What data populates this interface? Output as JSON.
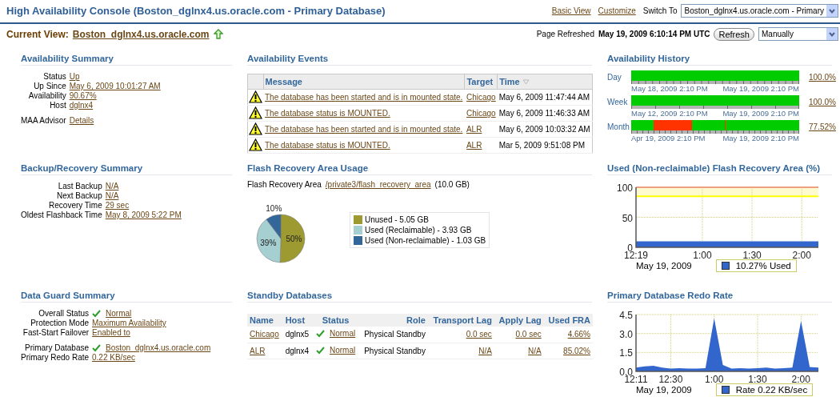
{
  "header": {
    "title": "High Availability Console (Boston_dglnx4.us.oracle.com - Primary Database)",
    "links": [
      "Basic View",
      "Customize"
    ],
    "switch_label": "Switch To",
    "switch_value": "Boston_dglnx4.us.oracle.com - Primary",
    "current_view_label": "Current View:",
    "current_view": "Boston_dglnx4.us.oracle.com",
    "refreshed_label": "Page Refreshed",
    "refreshed_time": "May 19, 2009 6:10:14 PM UTC",
    "refresh_button": "Refresh",
    "refresh_mode": "Manually"
  },
  "availability_summary": {
    "title": "Availability Summary",
    "groups": [
      [
        {
          "label": "Status",
          "value": "Up"
        },
        {
          "label": "Up Since",
          "value": "May 6, 2009 10:01:27 AM"
        },
        {
          "label": "Availability",
          "value": "90.67%"
        },
        {
          "label": "Host",
          "value": "dglnx4"
        }
      ],
      [
        {
          "label": "MAA Advisor",
          "value": "Details"
        }
      ]
    ]
  },
  "availability_events": {
    "title": "Availability Events",
    "columns": [
      {
        "label": "Message",
        "sorted": false
      },
      {
        "label": "Target",
        "sorted": false
      },
      {
        "label": "Time",
        "sorted": true
      }
    ],
    "rows": [
      {
        "kind": "warning",
        "message": "The database has been started and is in mounted state.",
        "target": "Chicago",
        "time": "May 6, 2009 11:47:44 AM"
      },
      {
        "kind": "warning",
        "message": "The database status is MOUNTED.",
        "target": "Chicago",
        "time": "May 6, 2009 11:46:33 AM"
      },
      {
        "kind": "warning",
        "message": "The database has been started and is in mounted state.",
        "target": "ALR",
        "time": "May 6, 2009 10:03:32 AM"
      },
      {
        "kind": "warning",
        "message": "The database status is MOUNTED.",
        "target": "ALR",
        "time": "Mar 5, 2009 9:51:08 PM"
      }
    ]
  },
  "availability_history": {
    "title": "Availability History",
    "rows": [
      {
        "kind": "day",
        "label": "Day",
        "percent": "100.0%",
        "start": "May 18, 2009 2:10 PM",
        "end": "May 19, 2009 2:10 PM"
      },
      {
        "kind": "week",
        "label": "Week",
        "percent": "100.0%",
        "start": "May 12, 2009 2:10 PM",
        "end": "May 19, 2009 2:10 PM"
      },
      {
        "kind": "month",
        "label": "Month",
        "percent": "77.52%",
        "start": "Apr 19, 2009 2:10 PM",
        "end": "May 19, 2009 2:10 PM"
      }
    ]
  },
  "backup_recovery_summary": {
    "title": "Backup/Recovery Summary",
    "groups": [
      [
        {
          "label": "Last Backup",
          "value": "N/A"
        },
        {
          "label": "Next Backup",
          "value": "N/A"
        },
        {
          "label": "Recovery Time",
          "value": "29 sec"
        },
        {
          "label": "Oldest Flashback Time",
          "value": "May 8, 2009 5:22 PM"
        }
      ]
    ]
  },
  "flash_recovery_area_usage": {
    "title": "Flash Recovery Area Usage",
    "label": "Flash Recovery Area",
    "path": "/private3/flash_recovery_area",
    "size": "(10.0 GB)",
    "chart_data": {
      "type": "pie",
      "categories": [
        "Unused - 5.05 GB",
        "Used (Reclaimable) - 3.93 GB",
        "Used (Non-reclaimable) - 1.03 GB"
      ],
      "series": [
        {
          "values": [
            50.5,
            39.2,
            10.3
          ]
        }
      ],
      "colors": [
        "#9c9a30",
        "#a6cfd2",
        "#336699"
      ],
      "value_labels": [
        "50%",
        "39%",
        "10%"
      ]
    }
  },
  "used_fra_chart": {
    "title": "Used (Non-reclaimable) Flash Recovery Area (%)",
    "chart_data": {
      "type": "area",
      "xlabel": "May 19, 2009",
      "categories": [
        "12:19",
        null,
        null,
        null,
        "1:00",
        null,
        null,
        "1:30",
        null,
        null,
        "2:00",
        null
      ],
      "series": [
        {
          "name": "10.27% Used",
          "color": "#3366cc",
          "values": [
            10,
            10,
            10,
            10,
            10,
            10,
            10,
            10,
            10,
            10,
            10,
            10
          ]
        }
      ],
      "ylim": [
        0,
        100
      ],
      "yticks": [
        0,
        50,
        100
      ],
      "grid": true,
      "ref_lines": [
        {
          "axis": "y",
          "value": 100,
          "color": "#f0a080"
        },
        {
          "axis": "y",
          "value": 85,
          "color": "#ffff00"
        }
      ],
      "bands": [
        {
          "axis": "y",
          "from": 85,
          "to": 100,
          "color": "#fffbd0"
        }
      ]
    }
  },
  "data_guard_summary": {
    "title": "Data Guard Summary",
    "groups": [
      [
        {
          "label": "Overall Status",
          "value": "Normal",
          "ok_mark": true
        },
        {
          "label": "Protection Mode",
          "value": "Maximum Availability",
          "ok_mark": false
        },
        {
          "label": "Fast-Start Failover",
          "value": "Enabled to",
          "ok_mark": false
        }
      ],
      [
        {
          "label": "Primary Database",
          "value": "Boston_dglnx4.us.oracle.com",
          "ok_mark": true
        },
        {
          "label": "Primary Redo Rate",
          "value": "0.22 KB/sec",
          "ok_mark": false
        }
      ]
    ]
  },
  "standby_databases": {
    "title": "Standby Databases",
    "columns": [
      "Name",
      "Host",
      "Status",
      "Role",
      "Transport Lag",
      "Apply Lag",
      "Used FRA"
    ],
    "rows": [
      {
        "name": "Chicago",
        "host": "dglnx5",
        "status": "Normal",
        "status_ok": true,
        "role": "Physical Standby",
        "transport_lag": "0.0 sec",
        "apply_lag": "0.0 sec",
        "used_fra": "4.66%"
      },
      {
        "name": "ALR",
        "host": "dglnx4",
        "status": "Normal",
        "status_ok": true,
        "role": "Physical Standby",
        "transport_lag": "N/A",
        "apply_lag": "N/A",
        "used_fra": "85.02%"
      }
    ]
  },
  "redo_rate_chart": {
    "title": "Primary Database Redo Rate",
    "chart_data": {
      "type": "area",
      "xlabel": "May 19, 2009",
      "categories": [
        "12:11",
        null,
        null,
        null,
        "12:30",
        null,
        null,
        null,
        null,
        "1:00",
        null,
        null,
        null,
        null,
        "1:30",
        null,
        null,
        null,
        null,
        "2:00",
        null,
        null
      ],
      "series": [
        {
          "name": "Rate 0.22 KB/sec",
          "color": "#3366cc",
          "values": [
            0.3,
            0.4,
            0.45,
            0.3,
            0.22,
            0.25,
            0.22,
            0.22,
            0.25,
            4.2,
            0.5,
            0.22,
            0.25,
            0.22,
            0.25,
            0.3,
            0.22,
            0.25,
            0.3,
            4.0,
            0.35,
            0.3
          ]
        }
      ],
      "ylim": [
        0,
        4.5
      ],
      "grid": true,
      "yticks": [
        {
          "value": 0,
          "label": "0.0"
        },
        {
          "value": 1.5,
          "label": "1.5"
        },
        {
          "value": 3,
          "label": "3.0"
        },
        {
          "value": 4.5,
          "label": "4.5"
        }
      ]
    }
  }
}
